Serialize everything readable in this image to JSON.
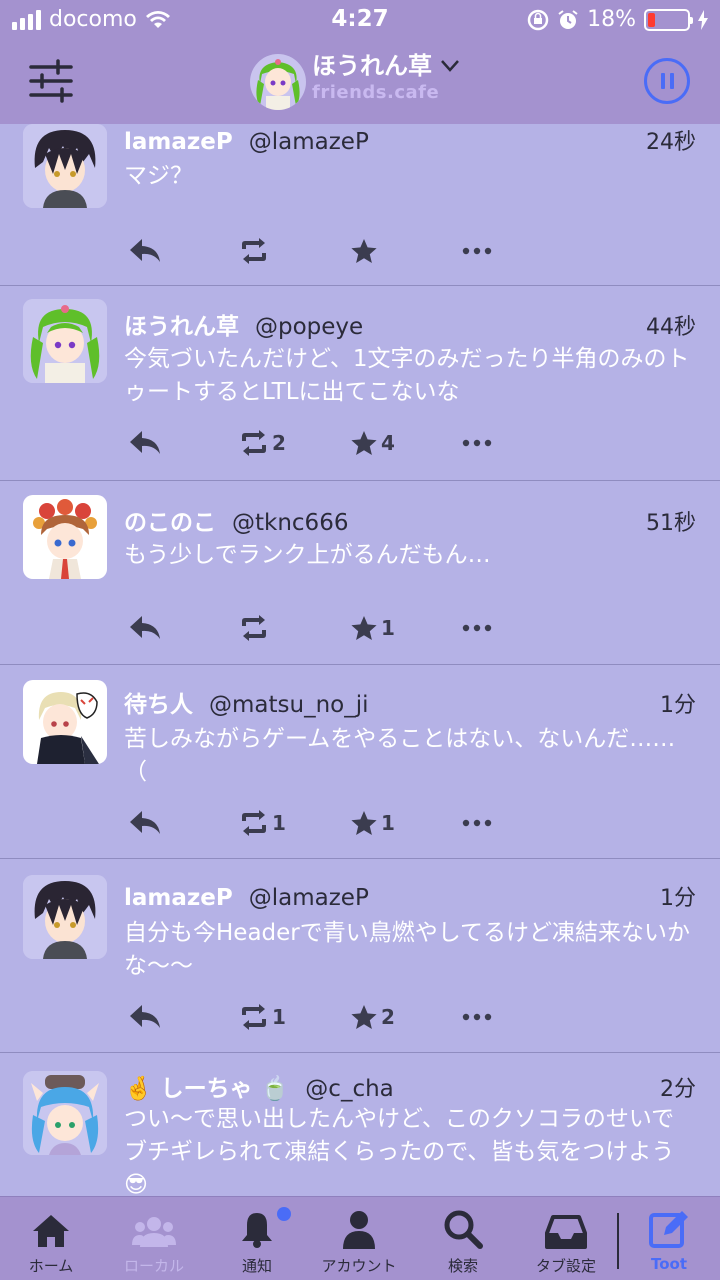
{
  "status_bar": {
    "carrier": "docomo",
    "time": "4:27",
    "battery_percent": "18%",
    "battery_level": 0.18,
    "battery_color": "#ff3b30"
  },
  "header": {
    "account_name": "ほうれん草",
    "instance": "friends.cafe",
    "filter_icon": "sliders-icon",
    "pause_icon": "pause-icon"
  },
  "colors": {
    "background": "#b5b2e6",
    "header": "#a492cf",
    "accent": "#4a6cf7"
  },
  "toots": [
    {
      "display_name": "lamazeP",
      "acct": "@lamazeP",
      "time": "24秒",
      "content": "マジ？",
      "boosts": "",
      "favs": ""
    },
    {
      "display_name": "ほうれん草",
      "acct": "@popeye",
      "time": "44秒",
      "content": "今気づいたんだけど、1文字のみだったり半角のみのトゥートするとLTLに出てこないな",
      "boosts": "2",
      "favs": "4"
    },
    {
      "display_name": "のこのこ",
      "acct": "@tknc666",
      "time": "51秒",
      "content": "もう少しでランク上がるんだもん…",
      "boosts": "",
      "favs": "1"
    },
    {
      "display_name": "待ち人",
      "acct": "@matsu_no_ji",
      "time": "1分",
      "content": "苦しみながらゲームをやることはない、ないんだ……（",
      "boosts": "1",
      "favs": "1"
    },
    {
      "display_name": "lamazeP",
      "acct": "@lamazeP",
      "time": "1分",
      "content": "自分も今Headerで青い鳥燃やしてるけど凍結来ないかな〜〜",
      "boosts": "1",
      "favs": "2"
    },
    {
      "display_name": "🤞 しーちゃ 🍵",
      "acct": "@c_cha",
      "time": "2分",
      "content": "つい〜で思い出したんやけど、このクソコラのせいでブチギレられて凍結くらったので、皆も気をつけよう😎",
      "boosts": "",
      "favs": ""
    }
  ],
  "nav": {
    "items": [
      {
        "label": "ホーム",
        "icon": "home-icon"
      },
      {
        "label": "ローカル",
        "icon": "people-icon"
      },
      {
        "label": "通知",
        "icon": "bell-icon"
      },
      {
        "label": "アカウント",
        "icon": "person-icon"
      },
      {
        "label": "検索",
        "icon": "search-icon"
      },
      {
        "label": "タブ設定",
        "icon": "inbox-icon"
      },
      {
        "label": "Toot",
        "icon": "compose-icon"
      }
    ]
  }
}
